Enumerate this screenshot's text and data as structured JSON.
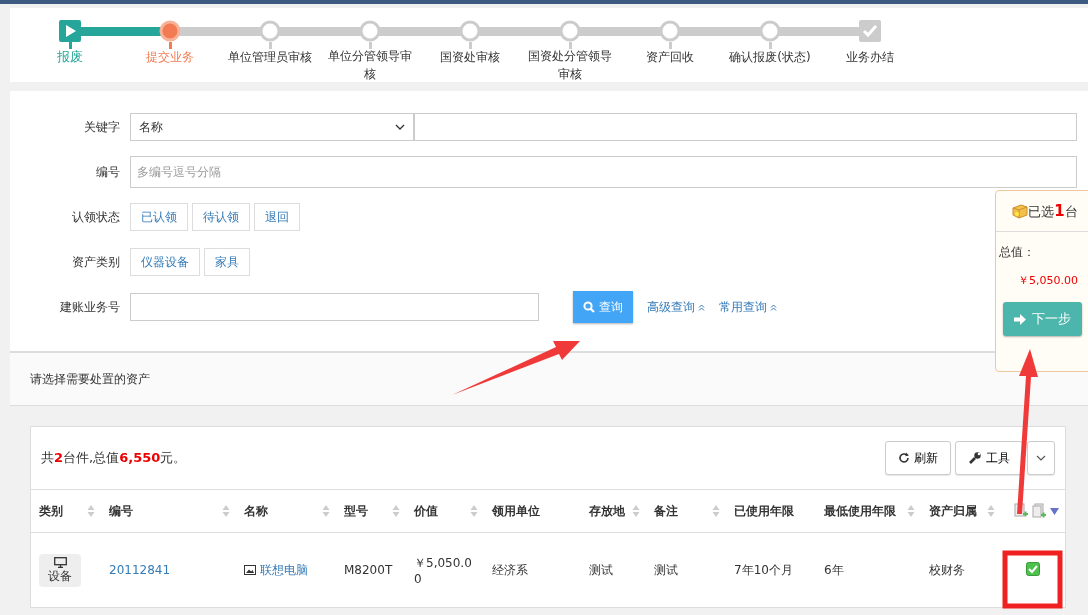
{
  "steps": [
    {
      "label": "报废",
      "kind": "done"
    },
    {
      "label": "提交业务",
      "kind": "current"
    },
    {
      "label": "单位管理员审核",
      "kind": "pending"
    },
    {
      "label": "单位分管领导审核",
      "kind": "pending"
    },
    {
      "label": "国资处审核",
      "kind": "pending"
    },
    {
      "label": "国资处分管领导审核",
      "kind": "pending"
    },
    {
      "label": "资产回收",
      "kind": "pending"
    },
    {
      "label": "确认报废(状态)",
      "kind": "pending"
    },
    {
      "label": "业务办结",
      "kind": "final"
    }
  ],
  "filters": {
    "keyword": {
      "label": "关键字",
      "select_value": "名称"
    },
    "number": {
      "label": "编号",
      "placeholder": "多编号逗号分隔"
    },
    "claim_status": {
      "label": "认领状态",
      "options": [
        "已认领",
        "待认领",
        "退回"
      ]
    },
    "category": {
      "label": "资产类别",
      "options": [
        "仪器设备",
        "家具"
      ]
    },
    "account_no": {
      "label": "建账业务号"
    },
    "search_button": "查询",
    "links": [
      "高级查询",
      "常用查询"
    ]
  },
  "selection_panel": {
    "title": "已选**1**台",
    "total_label": "总值：",
    "total": "￥5,050.00",
    "next_button": "下一步"
  },
  "section_title": "请选择需要处置的资产",
  "table": {
    "summary": "共**2**台件,总值**6,550**元。",
    "refresh_button": "刷新",
    "tools_button": "工具",
    "columns": [
      {
        "label": "类别",
        "sortable": true
      },
      {
        "label": "编号",
        "sortable": true
      },
      {
        "label": "名称",
        "sortable": true
      },
      {
        "label": "型号",
        "sortable": true
      },
      {
        "label": "价值",
        "sortable": true
      },
      {
        "label": "领用单位",
        "sortable": false
      },
      {
        "label": "存放地",
        "sortable": true
      },
      {
        "label": "备注",
        "sortable": true
      },
      {
        "label": "已使用年限",
        "sortable": false
      },
      {
        "label": "最低使用年限",
        "sortable": true
      },
      {
        "label": "资产归属",
        "sortable": true
      }
    ],
    "rows": [
      {
        "category": "设备",
        "number": "20112841",
        "name": "联想电脑",
        "model": "M8200T",
        "price": "￥5,050.00",
        "unit": "经济系",
        "location": "测试",
        "note": "测试",
        "used_years": "7年10个月",
        "min_years": "6年",
        "owner": "校财务",
        "checked": true
      }
    ]
  }
}
